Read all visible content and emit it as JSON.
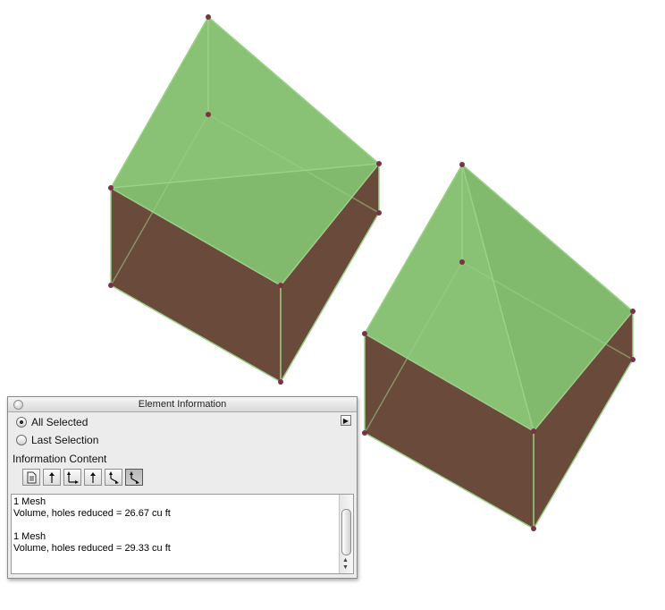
{
  "panel": {
    "title": "Element Information",
    "radio_options": [
      {
        "label": "All Selected",
        "selected": true
      },
      {
        "label": "Last Selection",
        "selected": false
      }
    ],
    "section_label": "Information Content",
    "tool_icons": [
      "document-icon",
      "arrow-up-icon",
      "arrow-up-right-icon",
      "arrow-up-icon",
      "arrow-down-right-icon",
      "arrow-down-right-active-icon"
    ],
    "info_lines": [
      {
        "line1": "1 Mesh",
        "line2": "Volume, holes reduced = 26.67 cu ft"
      },
      {
        "line1": "1 Mesh",
        "line2": "Volume, holes reduced = 29.33 cu ft"
      }
    ]
  },
  "colors": {
    "roof_green": "#89c175",
    "wall_brown": "#6a4a3a",
    "edge_green": "#9bd08a",
    "vertex": "#7a3346"
  }
}
